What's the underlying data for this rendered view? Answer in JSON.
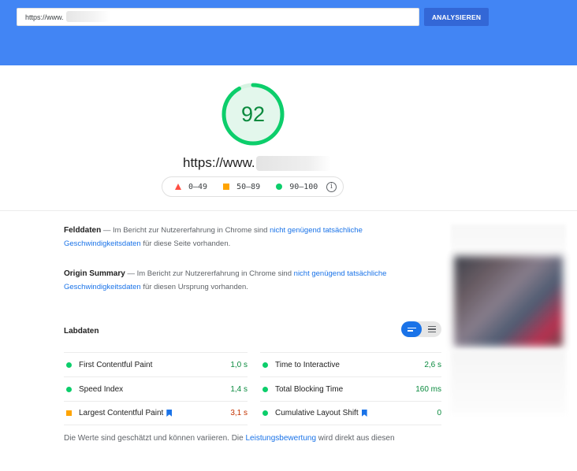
{
  "search": {
    "url_value": "https://www.",
    "analyze_label": "ANALYSIEREN"
  },
  "score": {
    "value": "92",
    "fraction": 0.92,
    "color": "#0cce6b",
    "track_color": "#e3f7ec"
  },
  "site": {
    "url": "https://www."
  },
  "legend": {
    "poor": "0–49",
    "average": "50–89",
    "good": "90–100"
  },
  "field_data": {
    "title": "Felddaten",
    "text_before": " — Im Bericht zur Nutzererfahrung in Chrome sind ",
    "link": "nicht genügend tatsächliche Geschwindigkeitsdaten",
    "text_after": " für diese Seite vorhanden."
  },
  "origin_summary": {
    "title": "Origin Summary",
    "text_before": " — Im Bericht zur Nutzererfahrung in Chrome sind ",
    "link": "nicht genügend tatsächliche Geschwindigkeitsdaten",
    "text_after": " für diesen Ursprung vorhanden."
  },
  "lab": {
    "title": "Labdaten",
    "metrics": [
      {
        "label": "First Contentful Paint",
        "value": "1,0 s",
        "status": "good"
      },
      {
        "label": "Speed Index",
        "value": "1,4 s",
        "status": "good"
      },
      {
        "label": "Largest Contentful Paint",
        "value": "3,1 s",
        "status": "average"
      },
      {
        "label": "Time to Interactive",
        "value": "2,6 s",
        "status": "good"
      },
      {
        "label": "Total Blocking Time",
        "value": "160 ms",
        "status": "good"
      },
      {
        "label": "Cumulative Layout Shift",
        "value": "0",
        "status": "good"
      }
    ]
  },
  "footer": {
    "text_before": "Die Werte sind geschätzt und können variieren. Die ",
    "link": "Leistungsbewertung",
    "text_after": " wird direkt aus diesen"
  },
  "colors": {
    "header": "#4285f4",
    "button": "#3367d6",
    "good": "#0cce6b",
    "average": "#ffa400",
    "poor": "#ff4e42",
    "link": "#1a73e8"
  }
}
